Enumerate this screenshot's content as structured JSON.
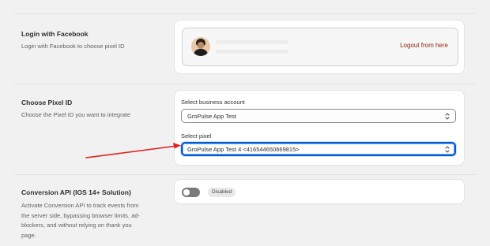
{
  "facebook_section": {
    "title": "Login with Facebook",
    "description": "Login with Facebook to choose pixel ID",
    "logout_label": "Logout from here"
  },
  "pixel_section": {
    "title": "Choose Pixel ID",
    "description": "Choose the Pixel ID you want to integrate",
    "business_account_label": "Select business account",
    "business_account_value": "GroPulse App Test",
    "pixel_label": "Select pixel",
    "pixel_value": "GroPulse App Test 4 <416544650669815>"
  },
  "conversion_section": {
    "title": "Conversion API (IOS 14+ Solution)",
    "description_lines": [
      "Activate Conversion API to track events from",
      "the server side, bypassing browser limits, ad-",
      "blockers, and without relying on thank you",
      "page."
    ],
    "toggle_on": false,
    "status_badge": "Disabled"
  },
  "colors": {
    "link": "#8e1f0b",
    "focus_border": "#005bd3",
    "annotation_arrow": "#e02020",
    "toggle_off": "#7a7a7a"
  },
  "icons": {
    "select_chevron": "chevron-up-down-icon",
    "avatar": "profile-photo"
  }
}
